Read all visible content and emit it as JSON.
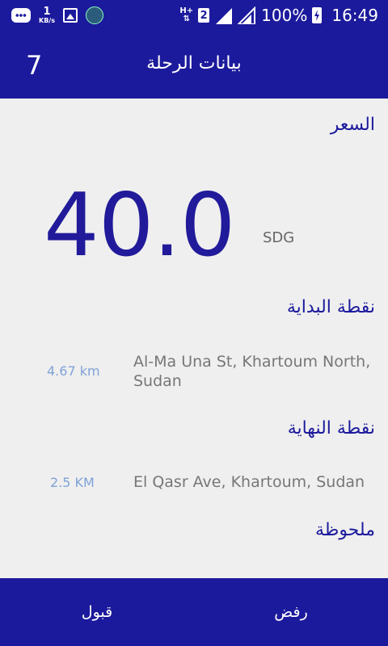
{
  "status_bar": {
    "data_rate": "1",
    "data_rate_unit": "KB/s",
    "network_type": "H+",
    "sim_slot": "2",
    "battery": "100%",
    "time": "16:49"
  },
  "app_bar": {
    "count": "7",
    "title": "بيانات الرحلة"
  },
  "trip": {
    "price_label": "السعر",
    "price_value": "40.0",
    "currency": "SDG",
    "start_label": "نقطة البداية",
    "start_distance": "4.67 km",
    "start_address_line1": "Al-Ma Una St, Khartoum North,",
    "start_address_line2": "Sudan",
    "end_label": "نقطة النهاية",
    "end_distance": "2.5 KM",
    "end_address": "El Qasr Ave, Khartoum, Sudan",
    "note_label": "ملحوظة"
  },
  "actions": {
    "accept_label": "قبول",
    "reject_label": "رفض"
  },
  "colors": {
    "primary": "#1c1a9c",
    "price_text": "#211a9a",
    "distance_text": "#7fa2d8",
    "background": "#efefef"
  }
}
